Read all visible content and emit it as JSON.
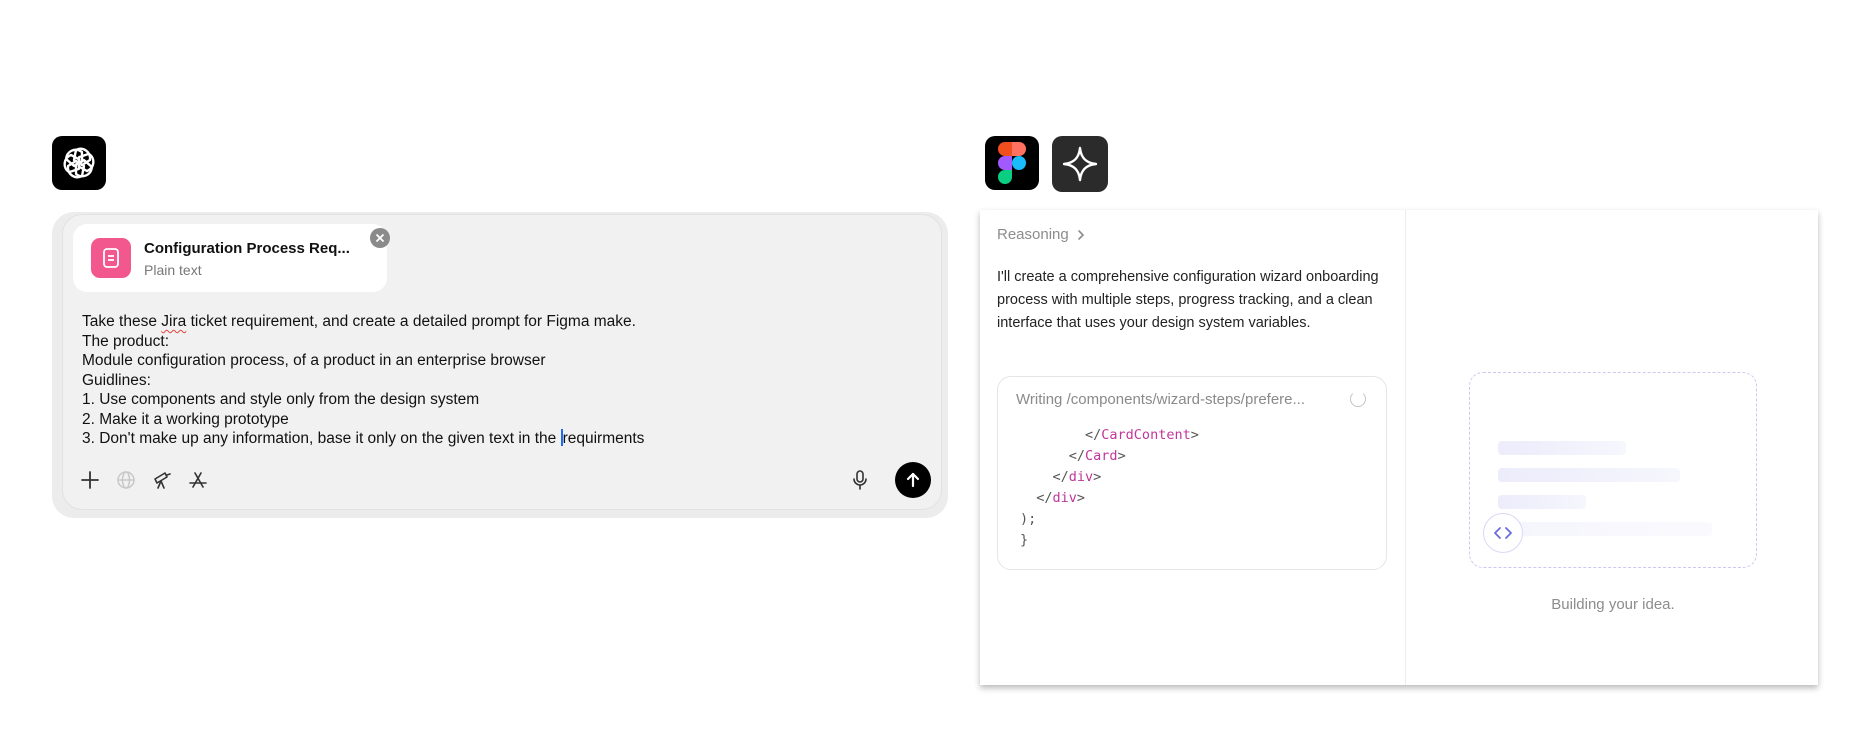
{
  "icons": {
    "chatgpt": "openai-logo-icon",
    "figma": "figma-logo-icon",
    "figma_make": "sparkle-star-icon"
  },
  "composer": {
    "attachment": {
      "title": "Configuration Process Req...",
      "subtitle": "Plain text",
      "icon": "document-icon",
      "accent": "#f2578d"
    },
    "prompt_lines": [
      "Take these Jira ticket requirement, and create a detailed prompt for Figma make.",
      "The product:",
      "Module configuration process, of a product in an enterprise browser",
      "Guidlines:",
      "1. Use components and style only from the design system",
      "2. Make it a working prototype",
      "3. Don't make up any information, base it only on the given text in the requirments"
    ],
    "tools": [
      "plus-icon",
      "globe-icon",
      "telescope-icon",
      "app-store-icon",
      "microphone-icon",
      "arrow-up-icon"
    ]
  },
  "make_panel": {
    "reasoning_label": "Reasoning",
    "assistant_message": "I'll create a comprehensive configuration wizard onboarding process with multiple steps, progress tracking, and a clean interface that uses your design system variables.",
    "code_card": {
      "header": "Writing /components/wizard-steps/prefere...",
      "lines": [
        {
          "indent": "        ",
          "tag": "</CardContent>"
        },
        {
          "indent": "      ",
          "tag": "</Card>"
        },
        {
          "indent": "    ",
          "tag": "</div>"
        },
        {
          "indent": "  ",
          "tag": "</div>"
        },
        {
          "indent": "",
          "text": ");"
        },
        {
          "indent": "",
          "text": "}"
        }
      ]
    },
    "building_text": "Building your idea."
  }
}
